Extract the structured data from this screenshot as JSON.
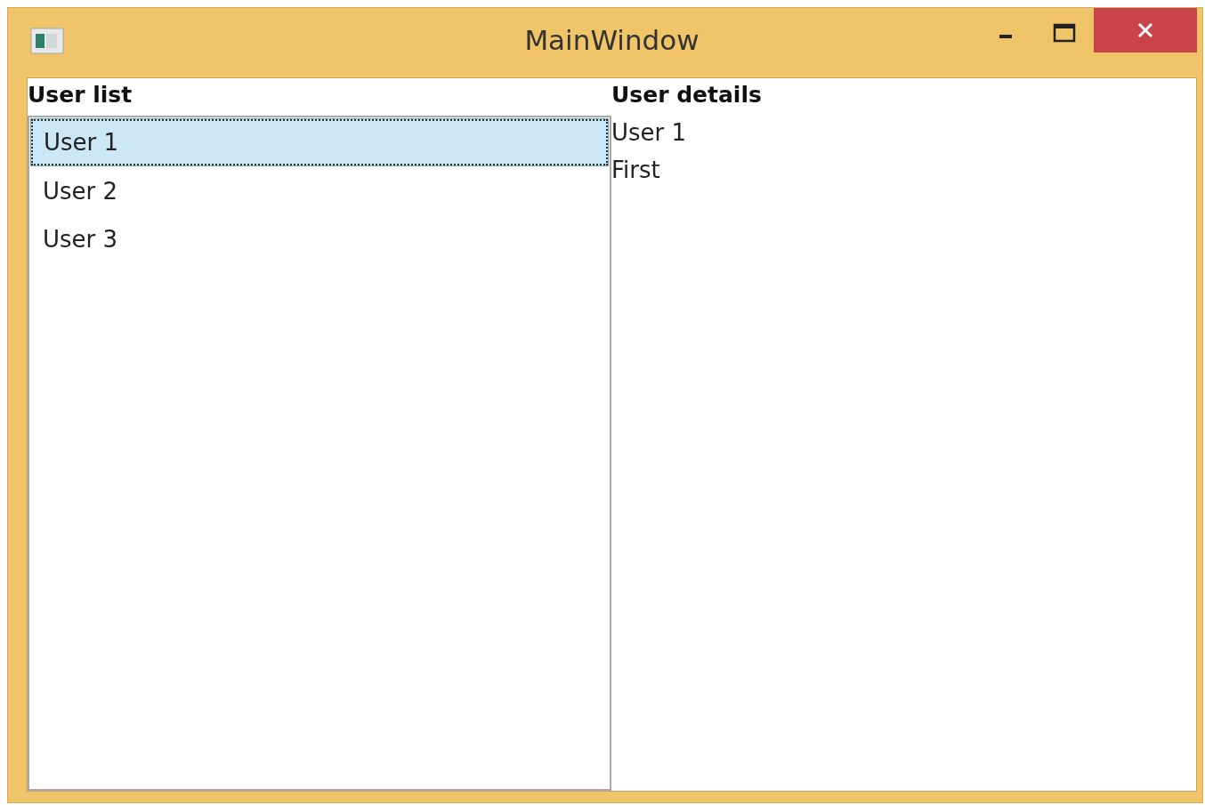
{
  "window": {
    "title": "MainWindow"
  },
  "user_list": {
    "heading": "User list",
    "items": [
      {
        "label": "User 1",
        "selected": true
      },
      {
        "label": "User 2",
        "selected": false
      },
      {
        "label": "User 3",
        "selected": false
      }
    ]
  },
  "user_details": {
    "heading": "User details",
    "lines": [
      "User 1",
      "First"
    ]
  }
}
